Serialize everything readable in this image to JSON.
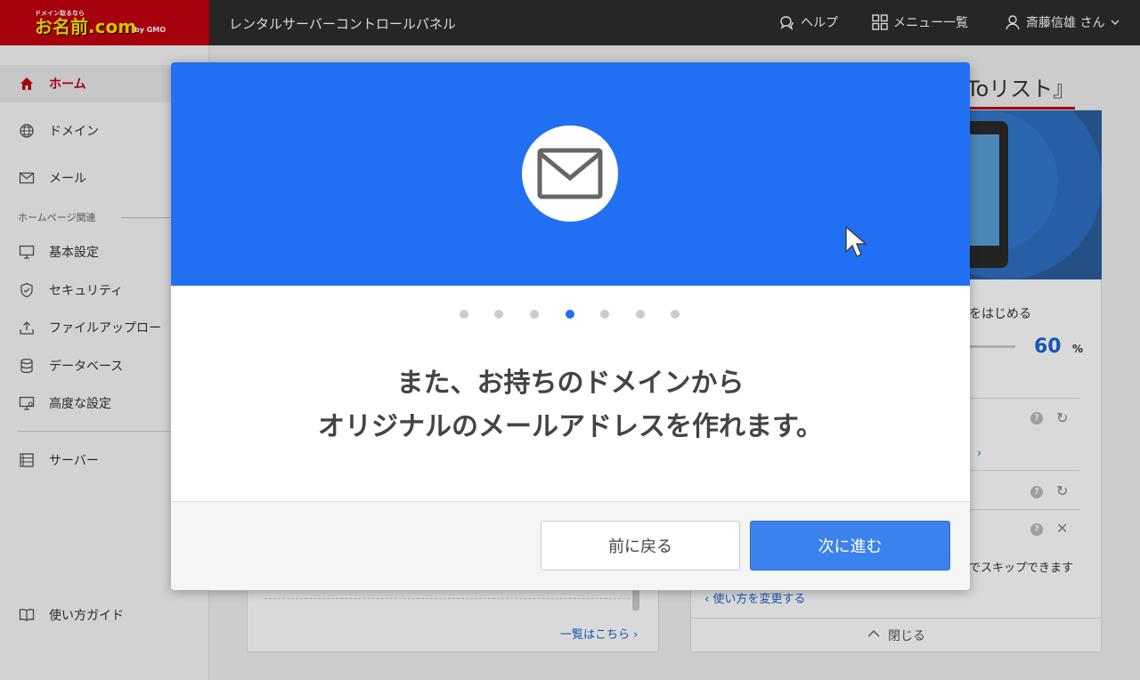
{
  "header": {
    "logo": {
      "tagline": "ドメイン取るなら",
      "brand": "お名前.com",
      "suffix": "by GMO"
    },
    "title": "レンタルサーバーコントロールパネル",
    "help": "ヘルプ",
    "menu": "メニュー一覧",
    "user": "斎藤信雄 さん"
  },
  "sidebar": {
    "items": [
      {
        "label": "ホーム"
      },
      {
        "label": "ドメイン"
      },
      {
        "label": "メール"
      }
    ],
    "group_label": "ホームページ関連",
    "group_items": [
      {
        "label": "基本設定"
      },
      {
        "label": "セキュリティ"
      },
      {
        "label": "ファイルアップロー"
      },
      {
        "label": "データベース"
      },
      {
        "label": "高度な設定"
      }
    ],
    "server": "サーバー",
    "guide": "使い方ガイド"
  },
  "background": {
    "todo_title": "Toリスト』",
    "start_text": "をはじめる",
    "progress_value": "60",
    "progress_unit": "%",
    "skip_text": "でスキップできます",
    "change_link": "‹ 使い方を変更する",
    "close_label": "閉じる",
    "list_link": "一覧はこちら ›",
    "mid_link": "›"
  },
  "modal": {
    "icon": "mail-icon",
    "total_steps": 7,
    "current_step": 4,
    "message_line1": "また、お持ちのドメインから",
    "message_line2": "オリジナルのメールアドレスを作れます。",
    "back_label": "前に戻る",
    "next_label": "次に進む"
  },
  "colors": {
    "brand_red": "#c4000f",
    "hero_blue": "#2170f3",
    "next_button": "#3b82ec",
    "link_blue": "#1a66d4"
  }
}
